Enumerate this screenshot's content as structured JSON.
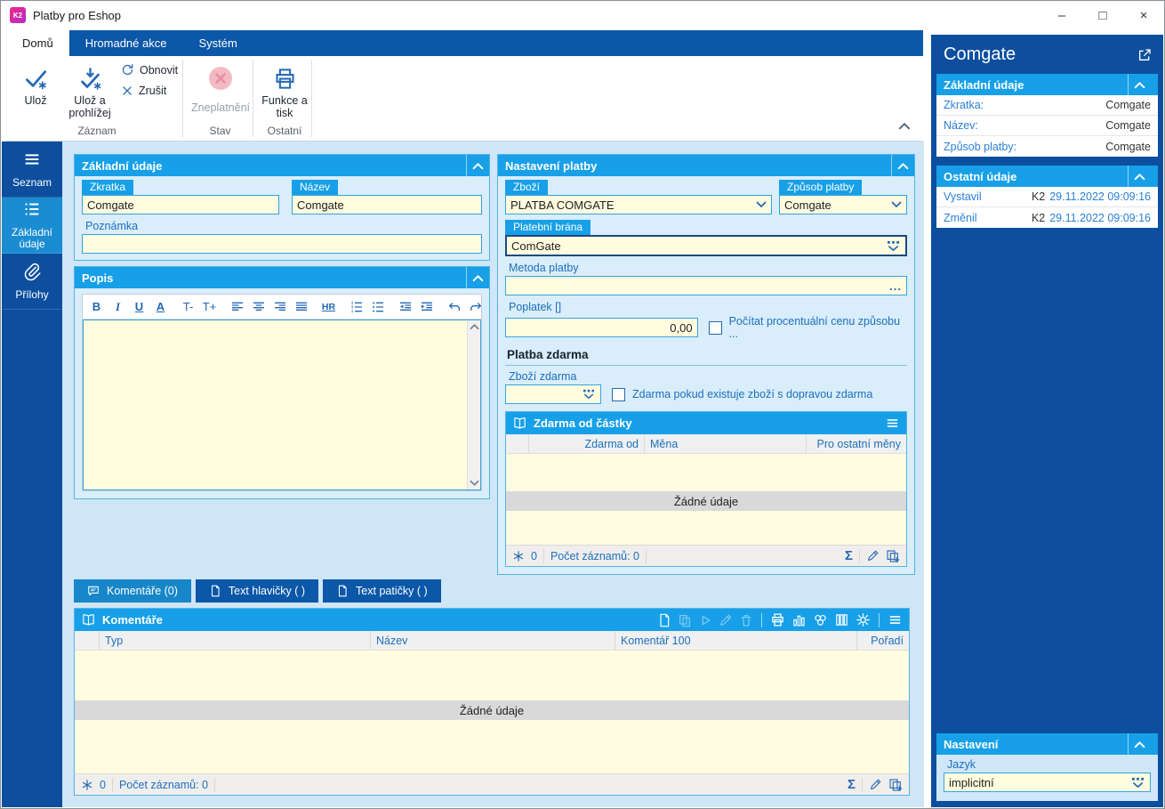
{
  "window": {
    "title": "Platby pro Eshop",
    "logo_text": "K2",
    "minimize": "–",
    "maximize": "□",
    "close": "×"
  },
  "ribbon": {
    "tabs": [
      "Domů",
      "Hromadné akce",
      "Systém"
    ],
    "buttons": {
      "uloz": "Ulož",
      "uloz_a_prohlizej": "Ulož a prohlížej",
      "obnovit": "Obnovit",
      "zrusit": "Zrušit",
      "zneplatneni": "Zneplatnění",
      "funkce_a_tisk": "Funkce a tisk"
    },
    "groups": [
      "Záznam",
      "Stav",
      "Ostatní"
    ]
  },
  "sidebar": {
    "items": [
      "Seznam",
      "Základní údaje",
      "Přílohy"
    ]
  },
  "basic_panel": {
    "title": "Základní údaje",
    "zkratka_label": "Zkratka",
    "zkratka_value": "Comgate",
    "nazev_label": "Název",
    "nazev_value": "Comgate",
    "poznamka_label": "Poznámka",
    "poznamka_value": ""
  },
  "popis_panel": {
    "title": "Popis",
    "toolbar": {
      "bold": "B",
      "italic": "I",
      "underline": "U",
      "color": "A",
      "font_down": "T-",
      "font_up": "T+",
      "hr": "HR"
    }
  },
  "payment_panel": {
    "title": "Nastavení platby",
    "zbozi_label": "Zboží",
    "zbozi_value": "PLATBA COMGATE",
    "zpusob_label": "Způsob platby",
    "zpusob_value": "Comgate",
    "brana_label": "Platební brána",
    "brana_value": "ComGate",
    "metoda_label": "Metoda platby",
    "metoda_value": "",
    "metoda_more": "...",
    "poplatek_label": "Poplatek []",
    "poplatek_value": "0,00",
    "percent_checkbox_label": "Počítat procentuální cenu způsobu ...",
    "free_heading": "Platba zdarma",
    "zbozi_zdarma_label": "Zboží zdarma",
    "zbozi_zdarma_value": "",
    "free_checkbox_label": "Zdarma pokud existuje zboží s dopravou zdarma",
    "grid": {
      "title": "Zdarma od částky",
      "columns": [
        "Zdarma od",
        "Měna",
        "Pro ostatní měny"
      ],
      "empty_text": "Žádné údaje",
      "footer": {
        "count": "0",
        "records": "Počet záznamů: 0",
        "sum": "Σ"
      }
    }
  },
  "bottom_tabs": [
    "Komentáře (0)",
    "Text hlavičky ( )",
    "Text patičky ( )"
  ],
  "comments_grid": {
    "title": "Komentáře",
    "columns": [
      "Typ",
      "Název",
      "Komentář 100",
      "Pořadí"
    ],
    "empty_text": "Žádné údaje",
    "footer": {
      "count": "0",
      "records": "Počet záznamů: 0",
      "sum": "Σ"
    }
  },
  "detail_panel": {
    "title": "Comgate",
    "basic": {
      "title": "Základní údaje",
      "rows": [
        {
          "label": "Zkratka:",
          "value": "Comgate"
        },
        {
          "label": "Název:",
          "value": "Comgate"
        },
        {
          "label": "Způsob platby:",
          "value": "Comgate"
        }
      ]
    },
    "other": {
      "title": "Ostatní údaje",
      "rows": [
        {
          "label": "Vystavil",
          "user": "K2",
          "date": "29.11.2022 09:09:16"
        },
        {
          "label": "Změnil",
          "user": "K2",
          "date": "29.11.2022 09:09:16"
        }
      ]
    },
    "settings": {
      "title": "Nastavení",
      "jazyk_label": "Jazyk",
      "jazyk_value": "implicitní"
    }
  },
  "colors": {
    "dark_blue": "#0d4f9e",
    "accent_blue": "#17a0e8",
    "active_item_blue": "#1a8cd2",
    "main_bg": "#cfe6f6",
    "input_bg": "#fffcdf",
    "icon_blue": "#2468b4",
    "label_blue": "#1c6fbd",
    "disabled_pink": "#f3bac4"
  }
}
